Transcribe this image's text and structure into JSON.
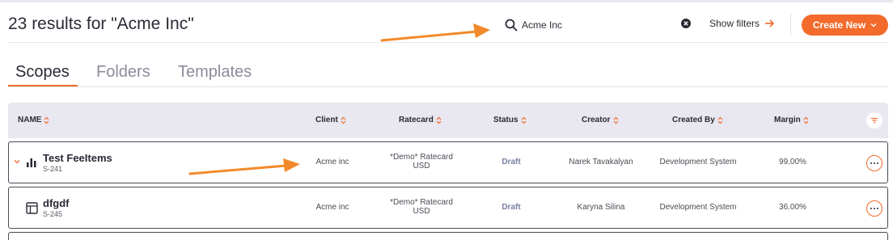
{
  "header": {
    "results_title": "23 results for \"Acme Inc\"",
    "search_value": "Acme Inc",
    "show_filters_label": "Show filters",
    "create_new_label": "Create New"
  },
  "tabs": [
    {
      "label": "Scopes",
      "active": true
    },
    {
      "label": "Folders",
      "active": false
    },
    {
      "label": "Templates",
      "active": false
    }
  ],
  "table": {
    "columns": [
      "NAME",
      "Client",
      "Ratecard",
      "Status",
      "Creator",
      "Created By",
      "Margin"
    ],
    "rows": [
      {
        "name": "Test FeeItems",
        "code": "S-241",
        "icon": "bar-chart-icon",
        "client": "Acme inc",
        "ratecard_line1": "*Demo* Ratecard",
        "ratecard_line2": "USD",
        "status": "Draft",
        "creator": "Narek Tavakalyan",
        "created_by": "Development System",
        "margin": "99.00%"
      },
      {
        "name": "dfgdf",
        "code": "S-245",
        "icon": "table-icon",
        "client": "Acme inc",
        "ratecard_line1": "*Demo* Ratecard",
        "ratecard_line2": "USD",
        "status": "Draft",
        "creator": "Karyna Silina",
        "created_by": "Development System",
        "margin": "36.00%"
      }
    ]
  },
  "colors": {
    "accent": "#f26b2c",
    "header_bg": "#e9e7ef",
    "status_draft": "#7a7fa3"
  }
}
